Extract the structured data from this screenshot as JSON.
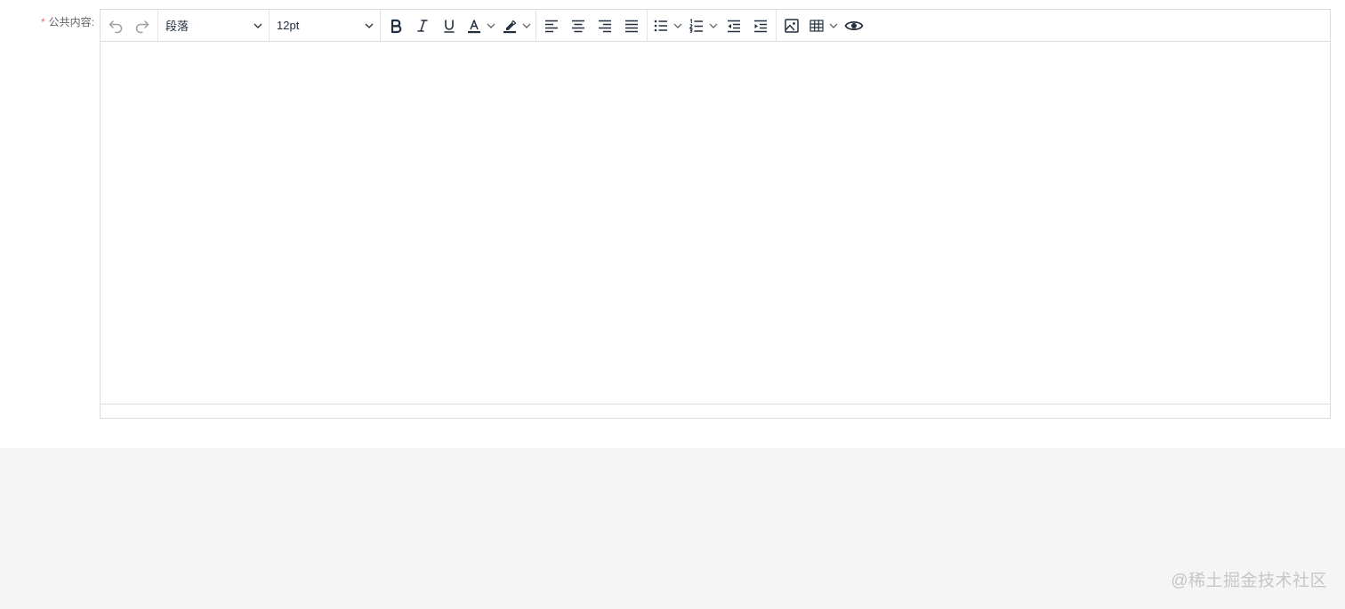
{
  "form": {
    "required_mark": "*",
    "label": "公共内容:"
  },
  "toolbar": {
    "undo_icon": "undo-icon",
    "redo_icon": "redo-icon",
    "block_format": "段落",
    "font_size": "12pt",
    "buttons": [
      "bold-icon",
      "italic-icon",
      "underline-icon",
      "text-color-icon",
      "highlight-icon",
      "align-left-icon",
      "align-center-icon",
      "align-right-icon",
      "align-justify-icon",
      "bullet-list-icon",
      "numbered-list-icon",
      "outdent-icon",
      "indent-icon",
      "image-icon",
      "table-icon",
      "preview-icon"
    ]
  },
  "editor": {
    "content": ""
  },
  "watermark": "@稀土掘金技术社区"
}
